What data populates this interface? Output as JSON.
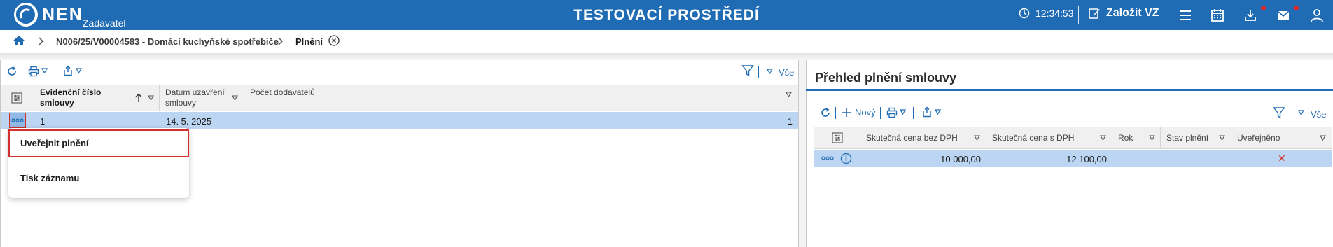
{
  "header": {
    "logo_text": "NEN",
    "logo_subtitle": "Zadavatel",
    "environment_title": "TESTOVACÍ PROSTŘEDÍ",
    "clock": "12:34:53",
    "create_label": "Založit VZ",
    "icons": [
      "clock-icon",
      "edit-icon",
      "menu-icon",
      "calendar-icon",
      "download-icon",
      "mail-icon",
      "user-icon"
    ],
    "notification_color": "#e5262e",
    "brand_color": "#1f6cb4"
  },
  "breadcrumb": {
    "items": [
      {
        "label": "N006/25/V00004583 - Domácí kuchyňské spotřebiče"
      },
      {
        "label": "Plnění"
      }
    ]
  },
  "left_grid": {
    "toolbar": {
      "filter_all_label": "Vše"
    },
    "columns": [
      {
        "label": "Evidenční číslo smlouvy",
        "sorted": "asc"
      },
      {
        "label": "Datum uzavření smlouvy"
      },
      {
        "label": "Počet dodavatelů"
      }
    ],
    "rows": [
      {
        "evidencni_cislo": "1",
        "datum": "14. 5. 2025",
        "pocet_dodavatelu": "1"
      }
    ],
    "context_menu": [
      {
        "label": "Uveřejnit plnění"
      },
      {
        "label": "Tisk záznamu"
      }
    ]
  },
  "right_panel": {
    "title": "Přehled plnění smlouvy",
    "toolbar": {
      "new_label": "Nový",
      "filter_all_label": "Vše"
    },
    "columns": [
      {
        "label": "Skutečná cena bez DPH"
      },
      {
        "label": "Skutečná cena s DPH"
      },
      {
        "label": "Rok"
      },
      {
        "label": "Stav plnění"
      },
      {
        "label": "Uveřejněno"
      }
    ],
    "rows": [
      {
        "cena_bez_dph": "10 000,00",
        "cena_s_dph": "12 100,00",
        "rok": "",
        "stav": "",
        "uverejneno": "✕"
      }
    ],
    "published_no_color": "#d0312d"
  }
}
